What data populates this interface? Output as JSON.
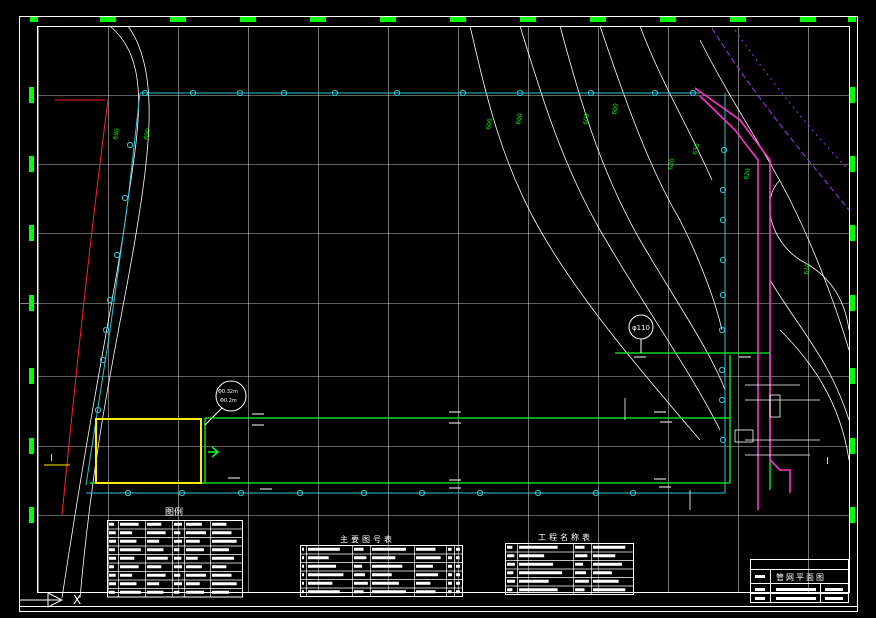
{
  "drawing": {
    "background": "#000000",
    "colors": {
      "grid": "#ffffff",
      "frame": "#ffffff",
      "border_ticks": "#00ff00",
      "cyan_line": "#2ec6d6",
      "green_line": "#00ff22",
      "yellow_line": "#ffee00",
      "magenta_line": "#ff33cc",
      "purple_line": "#aa33ff",
      "red_line": "#ff2222",
      "contour": "#ffffff",
      "contour_label": "#00ff00"
    }
  },
  "labels": {
    "legend_title": "图例",
    "table_a_title": "主要图号表",
    "table_b_title": "工程名称表",
    "title_block_name": "管网平面图",
    "section_left": "I",
    "section_right": "I",
    "axis_x": "X",
    "bubble_main": "φ110",
    "callout_left_top": "Φ0.32m",
    "callout_left_bottom": "Φ0.2m"
  },
  "contour_labels": [
    "690",
    "690",
    "600",
    "600",
    "600",
    "600",
    "620",
    "630",
    "620",
    "610"
  ]
}
